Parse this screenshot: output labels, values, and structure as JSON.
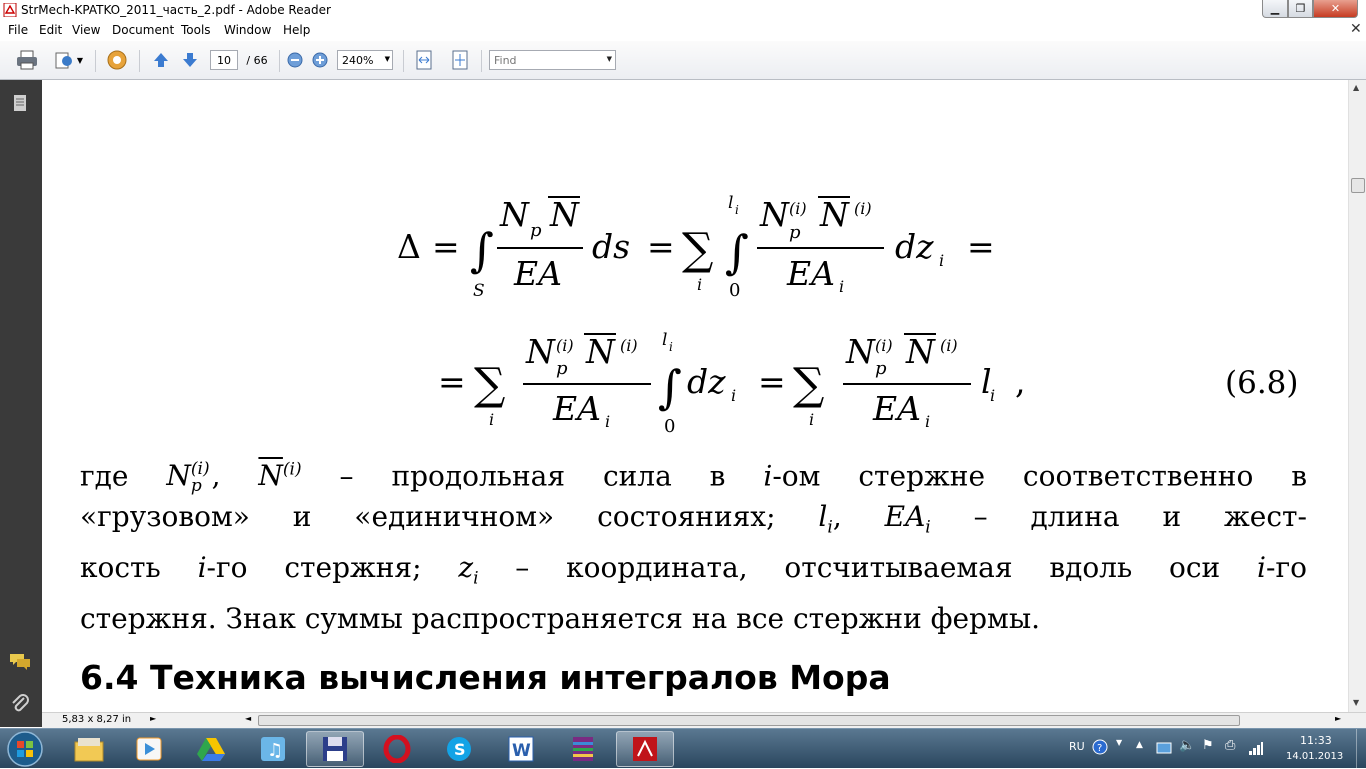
{
  "window": {
    "title": "StrMech-KPATKO_2011_часть_2.pdf - Adobe Reader"
  },
  "menu": [
    "File",
    "Edit",
    "View",
    "Document",
    "Tools",
    "Window",
    "Help"
  ],
  "toolbar": {
    "page_current": "10",
    "page_total": "/ 66",
    "zoom": "240%",
    "find_placeholder": "Find"
  },
  "document": {
    "equation_number": "(6.8)",
    "paragraph_lines": [
      {
        "parts": [
          "где ",
          "__M1__",
          " – продольная сила в ",
          "__I__",
          "-ом стержне соответственно в"
        ]
      },
      {
        "parts": [
          "«грузовом» и «единичном» состояниях; ",
          "__LI__",
          ", ",
          "__EAI__",
          " – длина и жест-"
        ]
      },
      {
        "parts": [
          "кость ",
          "__I__",
          "-го стержня; ",
          "__ZI__",
          " – координата, отсчитываемая вдоль оси ",
          "__I__",
          "-го"
        ]
      },
      {
        "parts": [
          "стержня. Знак суммы распространяется на все стержни фермы."
        ]
      }
    ],
    "section_heading": "6.4 Техника вычисления интегралов Мора"
  },
  "status": {
    "page_size": "5,83 x 8,27 in"
  },
  "taskbar": {
    "apps": [
      "explorer-icon",
      "media-player-icon",
      "gdrive-icon",
      "music-icon",
      "save-icon",
      "opera-icon",
      "skype-icon",
      "word-icon",
      "winrar-icon",
      "adobe-reader-icon"
    ]
  },
  "tray": {
    "lang": "RU",
    "time": "11:33",
    "date": "14.01.2013"
  },
  "colors": {
    "sidebar": "#3a3a3a",
    "taskbar": "#2a465e",
    "adobe_red": "#c0141a"
  }
}
